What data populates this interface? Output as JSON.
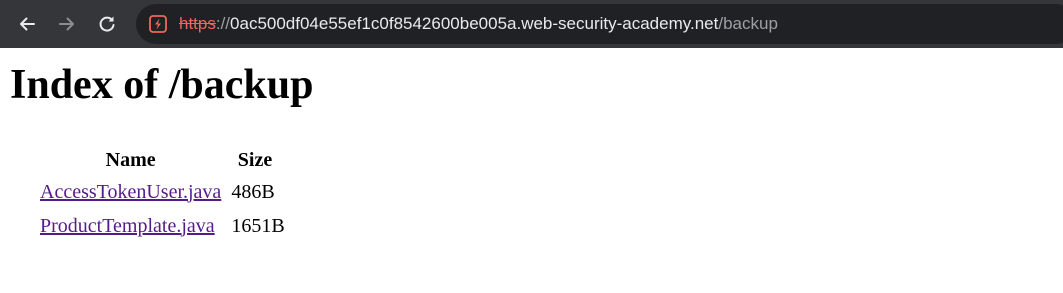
{
  "browser": {
    "url": {
      "scheme": "https",
      "separator": "://",
      "host": "0ac500df04e55ef1c0f8542600be005a.web-security-academy.net",
      "path": "/backup"
    },
    "colors": {
      "toolbar": "#35363a",
      "omnibox": "#202124",
      "insecure": "#ee675c"
    }
  },
  "page": {
    "title": "Index of /backup",
    "table": {
      "headers": {
        "name": "Name",
        "size": "Size"
      },
      "rows": [
        {
          "name": "AccessTokenUser.java",
          "size": "486B"
        },
        {
          "name": "ProductTemplate.java",
          "size": "1651B"
        }
      ]
    },
    "link_color": "#551a8b"
  }
}
